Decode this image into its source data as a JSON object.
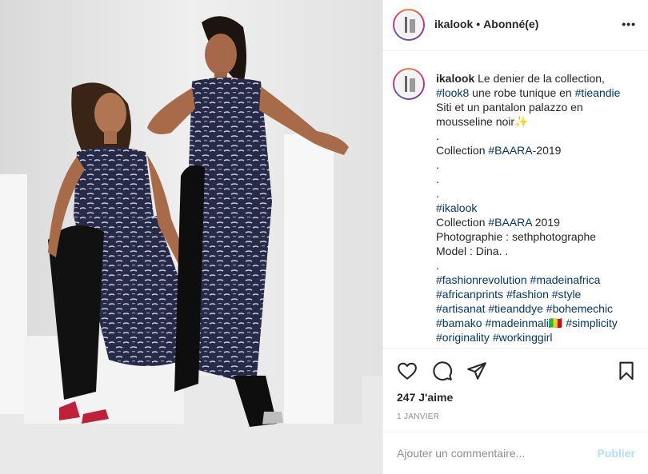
{
  "post": {
    "username": "ikalook",
    "separator": "•",
    "follow_status": "Abonné(e)",
    "more_label": "•••"
  },
  "caption": {
    "username": "ikalook",
    "lines": [
      [
        {
          "t": "Le denier de la collection,",
          "tag": false
        }
      ],
      [
        {
          "t": "#look8",
          "tag": true
        },
        {
          "t": " une robe tunique en ",
          "tag": false
        },
        {
          "t": "#tieandie",
          "tag": true
        }
      ],
      [
        {
          "t": "Siti et un pantalon palazzo en",
          "tag": false
        }
      ],
      [
        {
          "t": "mousseline noir✨",
          "tag": false
        }
      ],
      [
        {
          "t": ".",
          "tag": false
        }
      ],
      [
        {
          "t": "Collection ",
          "tag": false
        },
        {
          "t": "#BAARA",
          "tag": true
        },
        {
          "t": "-2019",
          "tag": false
        }
      ],
      [
        {
          "t": ".",
          "tag": false
        }
      ],
      [
        {
          "t": ".",
          "tag": false
        }
      ],
      [
        {
          "t": ".",
          "tag": false
        }
      ],
      [
        {
          "t": "#ikalook",
          "tag": true
        }
      ],
      [
        {
          "t": "Collection ",
          "tag": false
        },
        {
          "t": "#BAARA",
          "tag": true
        },
        {
          "t": " 2019",
          "tag": false
        }
      ],
      [
        {
          "t": "Photographie : sethphotographe",
          "tag": false
        }
      ],
      [
        {
          "t": "Model : Dina. .",
          "tag": false
        }
      ],
      [
        {
          "t": ".",
          "tag": false
        }
      ],
      [
        {
          "t": "#fashionrevolution",
          "tag": true
        },
        {
          "t": " ",
          "tag": false
        },
        {
          "t": "#madeinafrica",
          "tag": true
        }
      ],
      [
        {
          "t": "#africanprints",
          "tag": true
        },
        {
          "t": " ",
          "tag": false
        },
        {
          "t": "#fashion",
          "tag": true
        },
        {
          "t": " ",
          "tag": false
        },
        {
          "t": "#style",
          "tag": true
        }
      ],
      [
        {
          "t": "#artisanat",
          "tag": true
        },
        {
          "t": " ",
          "tag": false
        },
        {
          "t": "#tieanddye",
          "tag": true
        },
        {
          "t": " ",
          "tag": false
        },
        {
          "t": "#bohemechic",
          "tag": true
        }
      ],
      [
        {
          "t": "#bamako",
          "tag": true
        },
        {
          "t": " ",
          "tag": false
        },
        {
          "t": "#madeinmali",
          "tag": true
        },
        {
          "t": "🇲🇱 ",
          "tag": false
        },
        {
          "t": "#simplicity",
          "tag": true
        }
      ],
      [
        {
          "t": "#originality",
          "tag": true
        },
        {
          "t": " ",
          "tag": false
        },
        {
          "t": "#workinggirl",
          "tag": true
        }
      ]
    ]
  },
  "stats": {
    "likes": "247 J'aime",
    "date": "1 JANVIER"
  },
  "comment": {
    "placeholder": "Ajouter un commentaire...",
    "publish_label": "Publier"
  },
  "icons": {
    "like": "heart-icon",
    "comment": "comment-icon",
    "share": "share-icon",
    "save": "bookmark-icon"
  },
  "colors": {
    "hashtag": "#00376b",
    "publish_disabled": "#b2dffc",
    "muted": "#8e8e8e",
    "dress_navy": "#2b3050"
  }
}
